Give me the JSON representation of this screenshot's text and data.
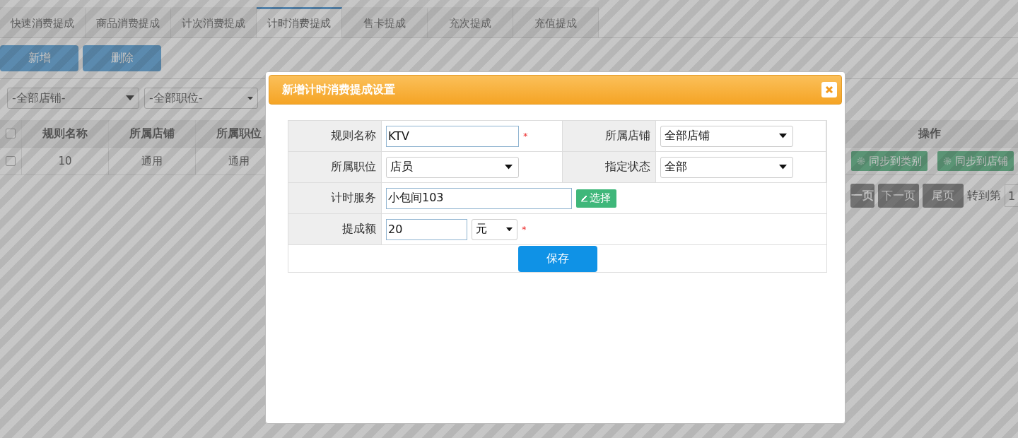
{
  "tabs": [
    {
      "label": "快速消费提成",
      "selected": false
    },
    {
      "label": "商品消费提成",
      "selected": false
    },
    {
      "label": "计次消费提成",
      "selected": false
    },
    {
      "label": "计时消费提成",
      "selected": true
    },
    {
      "label": "售卡提成",
      "selected": false
    },
    {
      "label": "充次提成",
      "selected": false
    },
    {
      "label": "充值提成",
      "selected": false
    }
  ],
  "toolbar_buttons": [
    "新增",
    "删除"
  ],
  "filters": [
    {
      "value": "-全部店铺-"
    },
    {
      "value": "-全部职位-"
    }
  ],
  "table": {
    "all_checked": false,
    "columns": [
      "规则名称",
      "所属店铺",
      "所属职位",
      "操作"
    ],
    "rows": [
      {
        "checked": false,
        "cells": [
          "10",
          "通用",
          "通用"
        ],
        "actions": [
          "同步到类别",
          "同步到店铺"
        ]
      }
    ]
  },
  "pagination": {
    "buttons": [
      "一页",
      "下一页",
      "尾页"
    ],
    "goto_label": "转到第",
    "page": "1"
  },
  "dialog": {
    "title": "新增计时消费提成设置",
    "rows": [
      [
        {
          "label": "规则名称",
          "kind": "text",
          "value": "KTV",
          "required": true,
          "required_mark": "*"
        },
        {
          "label": "所属店铺",
          "kind": "select",
          "value": "全部店铺"
        }
      ],
      [
        {
          "label": "所属职位",
          "kind": "select",
          "value": "店员"
        },
        {
          "label": "指定状态",
          "kind": "select",
          "value": "全部"
        }
      ],
      [
        {
          "label": "计时服务",
          "kind": "picker",
          "value": "小包间103",
          "button": "选择"
        }
      ],
      [
        {
          "label": "提成额",
          "kind": "amount",
          "value": "20",
          "unit": "元",
          "required": true,
          "required_mark": "*"
        }
      ]
    ],
    "save_button": "保存"
  }
}
